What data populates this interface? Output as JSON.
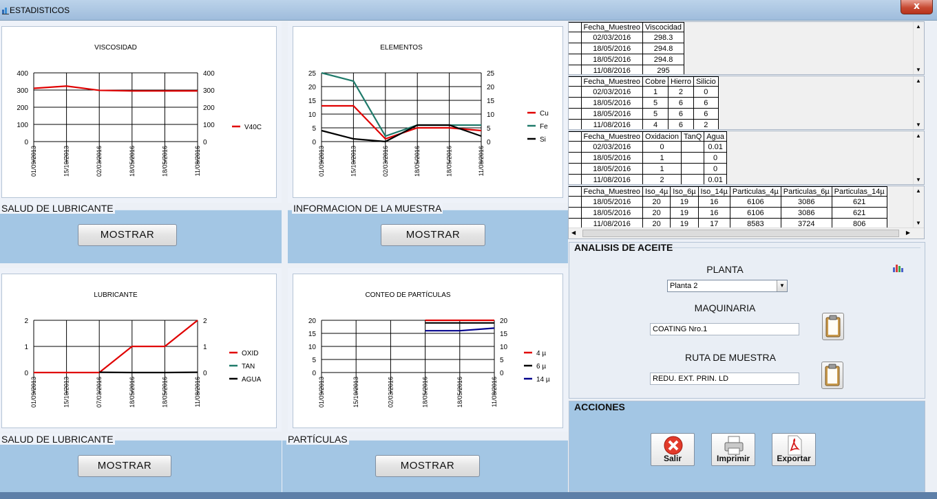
{
  "window": {
    "title": "ESTADISTICOS",
    "close_glyph": "x"
  },
  "charts": {
    "viscosidad": {
      "title": "VISCOSIDAD",
      "chart_data": {
        "type": "line",
        "title": "VISCOSIDAD",
        "categories": [
          "01/09/2013",
          "15/10/2013",
          "02/03/2016",
          "18/05/2016",
          "18/05/2016",
          "11/08/2016"
        ],
        "series": [
          {
            "name": "V40C",
            "color": "#e00000",
            "values": [
              310,
              323,
              298.3,
              294.8,
              294.8,
              295
            ]
          }
        ],
        "ylim": [
          0,
          400
        ],
        "yticks": [
          0,
          100,
          200,
          300,
          400
        ],
        "grid": true,
        "legend": "right"
      }
    },
    "elementos": {
      "title": "ELEMENTOS",
      "chart_data": {
        "type": "line",
        "title": "ELEMENTOS",
        "categories": [
          "01/09/2013",
          "15/10/2013",
          "02/03/2016",
          "18/05/2016",
          "18/05/2016",
          "11/08/2016"
        ],
        "series": [
          {
            "name": "Cu",
            "color": "#e00000",
            "values": [
              13,
              13,
              1,
              5,
              5,
              4
            ]
          },
          {
            "name": "Fe",
            "color": "#1f7a6a",
            "values": [
              25,
              22,
              2,
              6,
              6,
              6
            ]
          },
          {
            "name": "Si",
            "color": "#000000",
            "values": [
              4,
              1,
              0,
              6,
              6,
              2
            ]
          }
        ],
        "ylim": [
          0,
          25
        ],
        "yticks": [
          0,
          5,
          10,
          15,
          20,
          25
        ],
        "grid": true,
        "legend": "right"
      }
    },
    "lubricante": {
      "title": "LUBRICANTE",
      "chart_data": {
        "type": "line",
        "title": "LUBRICANTE",
        "categories": [
          "01/09/2013",
          "15/10/2013",
          "07/03/2016",
          "18/05/2016",
          "18/05/2016",
          "11/08/2016"
        ],
        "series": [
          {
            "name": "OXID",
            "color": "#e00000",
            "values": [
              0,
              0,
              0,
              1,
              1,
              2
            ]
          },
          {
            "name": "TAN",
            "color": "#1f7a6a",
            "values": [
              null,
              null,
              null,
              null,
              null,
              null
            ]
          },
          {
            "name": "AGUA",
            "color": "#000000",
            "values": [
              null,
              null,
              0.01,
              0,
              0,
              0.01
            ]
          }
        ],
        "ylim": [
          0,
          2
        ],
        "yticks": [
          0,
          1,
          2
        ],
        "grid": true,
        "legend": "right"
      }
    },
    "particulas": {
      "title": "CONTEO DE PARTÍCULAS",
      "chart_data": {
        "type": "line",
        "title": "CONTEO DE PARTÍCULAS",
        "categories": [
          "01/09/2013",
          "15/10/2013",
          "02/03/2016",
          "18/05/2016",
          "18/05/2016",
          "11/08/2016"
        ],
        "series": [
          {
            "name": "4 µ",
            "color": "#e00000",
            "values": [
              null,
              null,
              null,
              20,
              20,
              20
            ]
          },
          {
            "name": "6 µ",
            "color": "#000000",
            "values": [
              null,
              null,
              null,
              19,
              19,
              19
            ]
          },
          {
            "name": "14 µ",
            "color": "#00008b",
            "values": [
              null,
              null,
              null,
              16,
              16,
              17
            ]
          }
        ],
        "ylim": [
          0,
          20
        ],
        "yticks": [
          0,
          5,
          10,
          15,
          20
        ],
        "grid": true,
        "legend": "right"
      }
    }
  },
  "sections": {
    "salud1": {
      "label": "SALUD DE LUBRICANTE",
      "button": "MOSTRAR"
    },
    "info": {
      "label": "INFORMACION DE LA MUESTRA",
      "button": "MOSTRAR"
    },
    "salud2": {
      "label": "SALUD DE LUBRICANTE",
      "button": "MOSTRAR"
    },
    "particulas": {
      "label": "PARTÍCULAS",
      "button": "MOSTRAR"
    }
  },
  "grids": {
    "viscosidad": {
      "columns": [
        "Fecha_Muestreo",
        "Viscocidad"
      ],
      "rows": [
        [
          "02/03/2016",
          "298.3"
        ],
        [
          "18/05/2016",
          "294.8"
        ],
        [
          "18/05/2016",
          "294.8"
        ],
        [
          "11/08/2016",
          "295"
        ]
      ]
    },
    "elementos": {
      "columns": [
        "Fecha_Muestreo",
        "Cobre",
        "Hierro",
        "Silicio"
      ],
      "rows": [
        [
          "02/03/2016",
          "1",
          "2",
          "0"
        ],
        [
          "18/05/2016",
          "5",
          "6",
          "6"
        ],
        [
          "18/05/2016",
          "5",
          "6",
          "6"
        ],
        [
          "11/08/2016",
          "4",
          "6",
          "2"
        ]
      ]
    },
    "lubricante": {
      "columns": [
        "Fecha_Muestreo",
        "Oxidacion",
        "TanQ",
        "Agua"
      ],
      "rows": [
        [
          "02/03/2016",
          "0",
          "",
          "0.01"
        ],
        [
          "18/05/2016",
          "1",
          "",
          "0"
        ],
        [
          "18/05/2016",
          "1",
          "",
          "0"
        ],
        [
          "11/08/2016",
          "2",
          "",
          "0.01"
        ]
      ]
    },
    "particulas": {
      "columns": [
        "Fecha_Muestreo",
        "Iso_4µ",
        "Iso_6µ",
        "Iso_14µ",
        "Particulas_4µ",
        "Particulas_6µ",
        "Particulas_14µ"
      ],
      "rows": [
        [
          "18/05/2016",
          "20",
          "19",
          "16",
          "6106",
          "3086",
          "621"
        ],
        [
          "18/05/2016",
          "20",
          "19",
          "16",
          "6106",
          "3086",
          "621"
        ],
        [
          "11/08/2016",
          "20",
          "19",
          "17",
          "8583",
          "3724",
          "806"
        ]
      ]
    }
  },
  "analisis": {
    "title": "ANALISIS DE ACEITE",
    "planta_label": "PLANTA",
    "planta_value": "Planta 2",
    "maquinaria_label": "MAQUINARIA",
    "maquinaria_value": "COATING Nro.1",
    "ruta_label": "RUTA DE MUESTRA",
    "ruta_value": "REDU. EXT. PRIN. LD"
  },
  "acciones": {
    "title": "ACCIONES",
    "salir": "Salir",
    "imprimir": "Imprimir",
    "exportar": "Exportar"
  },
  "icons": {
    "app": "chart-icon",
    "clipboard": "clipboard-icon",
    "chart_small": "bar-chart-icon",
    "salir": "close-circle-icon",
    "imprimir": "printer-icon",
    "exportar": "pdf-icon"
  }
}
